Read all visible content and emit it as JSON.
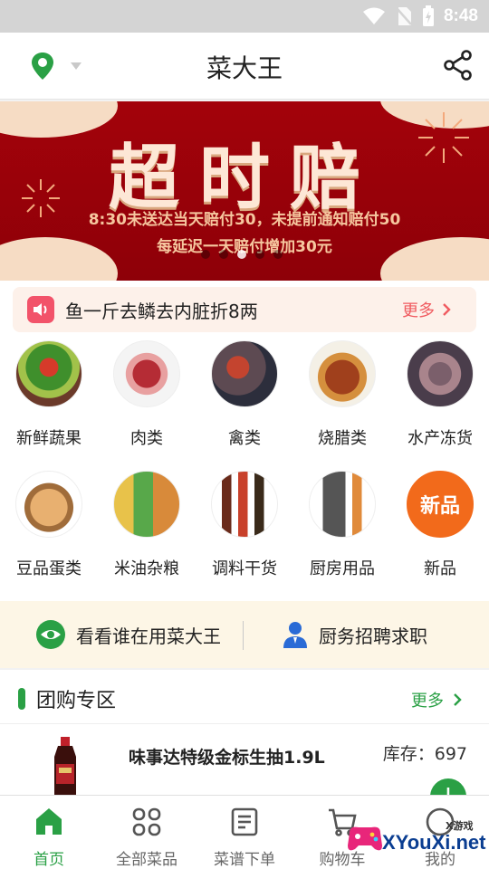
{
  "status_bar": {
    "time": "8:48"
  },
  "header": {
    "title": "菜大王"
  },
  "banner": {
    "headline": "超时赔",
    "line1": "8:30未送达当天赔付30，未提前通知赔付50",
    "line2": "每延迟一天赔付增加30元",
    "active_dot": 2
  },
  "notice": {
    "text": "鱼一斤去鳞去内脏折8两",
    "more": "更多"
  },
  "categories": [
    {
      "label": "新鲜蔬果",
      "icon": "vegetables-image"
    },
    {
      "label": "肉类",
      "icon": "meat-image"
    },
    {
      "label": "禽类",
      "icon": "poultry-image"
    },
    {
      "label": "烧腊类",
      "icon": "roast-duck-image"
    },
    {
      "label": "水产冻货",
      "icon": "seafood-image"
    },
    {
      "label": "豆品蛋类",
      "icon": "eggs-image"
    },
    {
      "label": "米油杂粮",
      "icon": "rice-oil-image"
    },
    {
      "label": "调料干货",
      "icon": "seasoning-image"
    },
    {
      "label": "厨房用品",
      "icon": "knife-set-image"
    },
    {
      "label": "新品",
      "icon": "new-product-badge",
      "badge_text": "新品"
    }
  ],
  "promo": {
    "left": "看看谁在用菜大王",
    "right": "厨务招聘求职"
  },
  "group_buy": {
    "title": "团购专区",
    "more": "更多"
  },
  "product": {
    "name": "味事达特级金标生抽1.9L",
    "stock": "库存：697"
  },
  "tabbar": [
    {
      "label": "首页",
      "active": true
    },
    {
      "label": "全部菜品"
    },
    {
      "label": "菜谱下单"
    },
    {
      "label": "购物车"
    },
    {
      "label": "我的"
    }
  ],
  "watermark": {
    "brand": "XYouXi.net",
    "small": "X游戏"
  },
  "colors": {
    "accent": "#2aa045",
    "banner": "#a3020a",
    "notice_bg": "#fdf1ea",
    "promo_bg": "#fdf6e6"
  }
}
